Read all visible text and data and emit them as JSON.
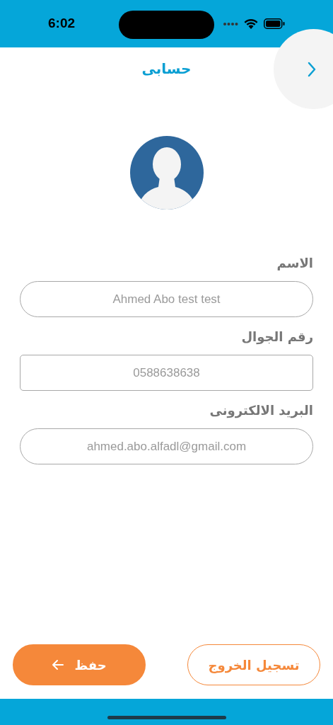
{
  "status_bar": {
    "time": "6:02"
  },
  "header": {
    "title": "حسابى"
  },
  "fields": [
    {
      "label": "الاسم",
      "value": "Ahmed Abo test test",
      "kind": "pill"
    },
    {
      "label": "رقم الجوال",
      "value": "0588638638",
      "kind": "box"
    },
    {
      "label": "البريد الالكترونى",
      "value": "ahmed.abo.alfadl@gmail.com",
      "kind": "pill"
    }
  ],
  "buttons": [
    {
      "label": "تسجيل الخروج",
      "kind": "outline"
    },
    {
      "label": "حفظ",
      "kind": "primary"
    }
  ]
}
